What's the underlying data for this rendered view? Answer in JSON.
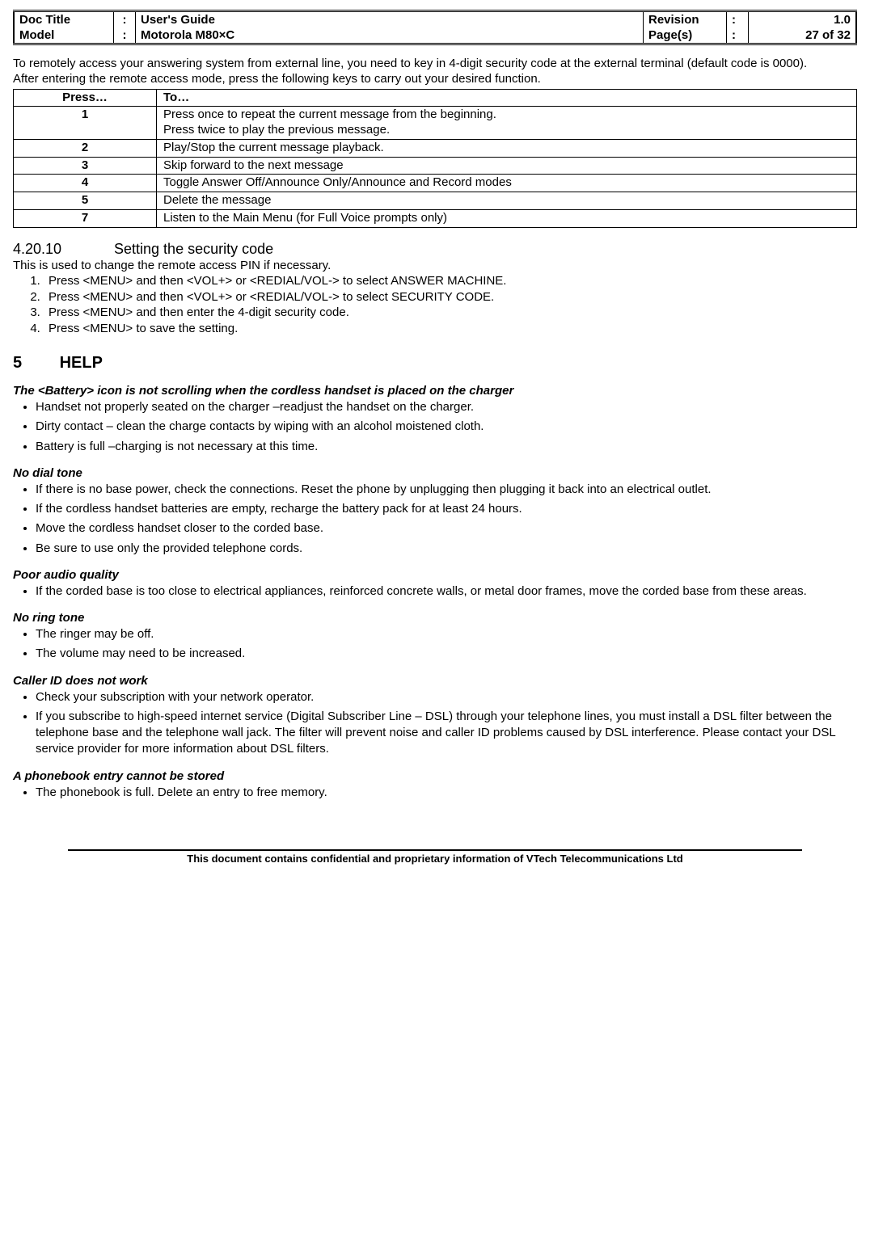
{
  "header": {
    "docTitleLabel": "Doc Title",
    "docTitleValue": "User's Guide",
    "modelLabel": "Model",
    "modelValue": "Motorola M80×C",
    "revisionLabel": "Revision",
    "revisionValue": "1.0",
    "pagesLabel": "Page(s)",
    "pagesValue": "27 of 32"
  },
  "intro": {
    "p1": "To remotely access your answering system from external line, you need to key in 4-digit security code at the external terminal (default code is 0000).",
    "p2": "After entering the remote access mode, press the following keys to carry out your desired function."
  },
  "pressTable": {
    "headPress": "Press…",
    "headTo": "To…",
    "rows": [
      {
        "key": "1",
        "action": "Press once to repeat the current message from the beginning.\nPress twice to play the previous message."
      },
      {
        "key": "2",
        "action": "Play/Stop the current message playback."
      },
      {
        "key": "3",
        "action": "Skip forward to the next message"
      },
      {
        "key": "4",
        "action": "Toggle Answer Off/Announce Only/Announce and Record modes"
      },
      {
        "key": "5",
        "action": "Delete the message"
      },
      {
        "key": "7",
        "action": "Listen to the Main Menu (for Full Voice prompts only)"
      }
    ]
  },
  "section42010": {
    "num": "4.20.10",
    "title": "Setting the security code",
    "intro": "This is used to change the remote access PIN if necessary.",
    "steps": [
      "Press <MENU> and then <VOL+> or <REDIAL/VOL-> to select ANSWER MACHINE.",
      "Press <MENU> and then <VOL+> or <REDIAL/VOL-> to select SECURITY CODE.",
      "Press <MENU> and then enter the 4-digit security code.",
      "Press <MENU> to save the setting."
    ]
  },
  "helpSection": {
    "num": "5",
    "title": "HELP",
    "issues": [
      {
        "title": "The <Battery> icon is not scrolling when the cordless handset is placed on the charger",
        "bullets": [
          "Handset not properly seated on the charger –readjust the handset on the charger.",
          "Dirty contact – clean the charge contacts by wiping with an alcohol moistened cloth.",
          "Battery is full –charging is not necessary at this time."
        ]
      },
      {
        "title": "No dial tone",
        "bullets": [
          "If there is no base power, check the connections. Reset the phone by unplugging then plugging it back into an electrical outlet.",
          "If the cordless handset batteries are empty, recharge the battery pack for at least 24 hours.",
          "Move the cordless handset closer to the corded base.",
          "Be sure to use only the provided telephone cords."
        ]
      },
      {
        "title": "Poor audio quality",
        "bullets": [
          "If the corded base is too close to electrical appliances, reinforced concrete walls, or metal door frames, move the corded base from these areas."
        ]
      },
      {
        "title": "No ring tone",
        "bullets": [
          "The ringer may be off.",
          "The volume may need to be increased."
        ]
      },
      {
        "title": "Caller ID does not work",
        "bullets": [
          "Check your subscription with your network operator.",
          "If you subscribe to high-speed internet service (Digital Subscriber Line – DSL) through your telephone lines, you must install a DSL filter between the telephone base and the telephone wall jack. The filter will prevent noise and caller ID problems caused by DSL interference. Please contact your DSL service provider for more information about DSL filters."
        ]
      },
      {
        "title": "A phonebook entry cannot be stored",
        "bullets": [
          "The phonebook is full. Delete an entry to free memory."
        ]
      }
    ]
  },
  "footer": "This document contains confidential and proprietary information of VTech Telecommunications Ltd"
}
